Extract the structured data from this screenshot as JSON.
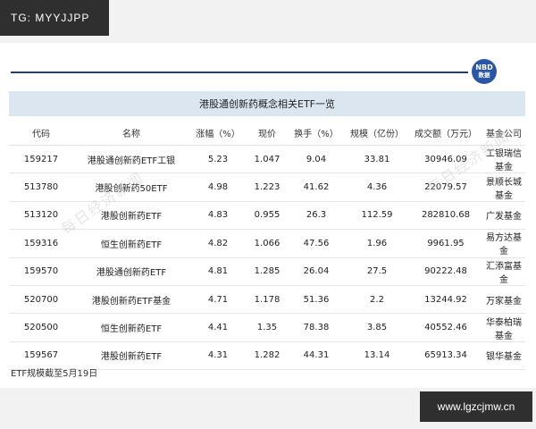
{
  "watermark_tag": "TG: MYYJJPP",
  "logo": {
    "line1": "NBD",
    "line2": "数据"
  },
  "table_title": "港股通创新药概念相关ETF一览",
  "watermark_text": "每日经济新闻",
  "columns": [
    "代码",
    "名称",
    "涨幅（%）",
    "现价",
    "换手（%）",
    "规模（亿份）",
    "成交额（万元）",
    "基金公司"
  ],
  "rows": [
    [
      "159217",
      "港股通创新药ETF工银",
      "5.23",
      "1.047",
      "9.04",
      "33.81",
      "30946.09",
      "工银瑞信基金"
    ],
    [
      "513780",
      "港股创新药50ETF",
      "4.98",
      "1.223",
      "41.62",
      "4.36",
      "22079.57",
      "景顺长城基金"
    ],
    [
      "513120",
      "港股创新药ETF",
      "4.83",
      "0.955",
      "26.3",
      "112.59",
      "282810.68",
      "广发基金"
    ],
    [
      "159316",
      "恒生创新药ETF",
      "4.82",
      "1.066",
      "47.56",
      "1.96",
      "9961.95",
      "易方达基金"
    ],
    [
      "159570",
      "港股通创新药ETF",
      "4.81",
      "1.285",
      "26.04",
      "27.5",
      "90222.48",
      "汇添富基金"
    ],
    [
      "520700",
      "港股创新药ETF基金",
      "4.71",
      "1.178",
      "51.36",
      "2.2",
      "13244.92",
      "万家基金"
    ],
    [
      "520500",
      "恒生创新药ETF",
      "4.41",
      "1.35",
      "78.38",
      "3.85",
      "40552.46",
      "华泰柏瑞基金"
    ],
    [
      "159567",
      "港股创新药ETF",
      "4.31",
      "1.282",
      "44.31",
      "13.14",
      "65913.34",
      "银华基金"
    ]
  ],
  "note": "ETF规模截至5月19日",
  "site_tag": "www.lgzcjmw.cn",
  "colors": {
    "header_bg": "#dbe6f1",
    "rule": "#2a3b6e",
    "logo": "#2b56a6"
  }
}
